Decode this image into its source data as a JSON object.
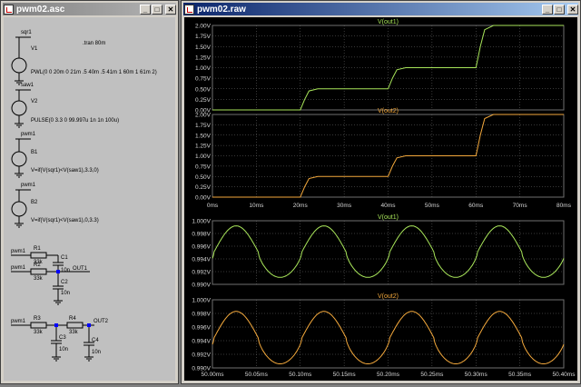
{
  "schematic_window": {
    "title": "pwm02.asc",
    "controls": {
      "minimize": "_",
      "maximize": "□",
      "close": "✕"
    },
    "directive": ".tran 80m",
    "sources": [
      {
        "net": "sqr1",
        "ref": "V1",
        "value": "PWL(0 0 20m 0 21m .5 40m .5 41m 1 60m 1 61m 2)"
      },
      {
        "net": "saw1",
        "ref": "V2",
        "value": "PULSE(0 3.3 0 99.997u 1n 1n 100u)"
      },
      {
        "net": "pwm1",
        "ref": "B1",
        "value": "V=if(V(sqr1)<V(saw1),3.3,0)"
      },
      {
        "net": "pwm1",
        "ref": "B2",
        "value": "V=if(V(sqr1)<V(saw1),0,3.3)"
      }
    ],
    "filter1": {
      "in1": "pwm1",
      "in2": "pwm1",
      "r1": "R1",
      "r1_val": "33k",
      "r2": "R2",
      "r2_val": "33k",
      "c1": "C1",
      "c1_val": "10n",
      "c2": "C2",
      "c2_val": "10n",
      "out": "OUT1"
    },
    "filter2": {
      "in": "pwm1",
      "r3": "R3",
      "r3_val": "33k",
      "r4": "R4",
      "r4_val": "33k",
      "c3": "C3",
      "c3_val": "10n",
      "c4": "C4",
      "c4_val": "10n",
      "out": "OUT2"
    }
  },
  "waveform_window": {
    "title": "pwm02.raw",
    "controls": {
      "minimize": "_",
      "maximize": "□",
      "close": "✕"
    }
  },
  "colors": {
    "out1": "#a8e55a",
    "out2": "#f4a93c",
    "grid": "#707070",
    "axis_text": "#d8d8d8",
    "background": "#000000"
  },
  "chart_data": [
    {
      "type": "line",
      "title": "V(out1)",
      "x_unit": "ms",
      "xlim": [
        0,
        80
      ],
      "x_tick_labels": [
        "0ms",
        "10ms",
        "20ms",
        "30ms",
        "40ms",
        "50ms",
        "60ms",
        "70ms",
        "80ms"
      ],
      "ylim": [
        0,
        2.0
      ],
      "y_tick_labels": [
        "2.00V",
        "1.75V",
        "1.50V",
        "1.25V",
        "1.00V",
        "0.75V",
        "0.50V",
        "0.25V",
        "0.00V"
      ],
      "grid": true,
      "series": [
        {
          "name": "V(out1)",
          "x": [
            0,
            20,
            21,
            22,
            24,
            40,
            41,
            42,
            44,
            60,
            61,
            62,
            64,
            80
          ],
          "y": [
            0,
            0,
            0.25,
            0.45,
            0.5,
            0.5,
            0.75,
            0.95,
            1.0,
            1.0,
            1.5,
            1.9,
            2.0,
            2.0
          ]
        }
      ]
    },
    {
      "type": "line",
      "title": "V(out2)",
      "x_unit": "ms",
      "xlim": [
        0,
        80
      ],
      "x_tick_labels": [
        "0ms",
        "10ms",
        "20ms",
        "30ms",
        "40ms",
        "50ms",
        "60ms",
        "70ms",
        "80ms"
      ],
      "ylim": [
        0,
        2.0
      ],
      "y_tick_labels": [
        "2.00V",
        "1.75V",
        "1.50V",
        "1.25V",
        "1.00V",
        "0.75V",
        "0.50V",
        "0.25V",
        "0.00V"
      ],
      "grid": true,
      "series": [
        {
          "name": "V(out2)",
          "x": [
            0,
            20,
            21,
            22,
            24,
            40,
            41,
            42,
            44,
            60,
            61,
            62,
            64,
            80
          ],
          "y": [
            0,
            0,
            0.25,
            0.45,
            0.5,
            0.5,
            0.75,
            0.95,
            1.0,
            1.0,
            1.5,
            1.9,
            2.0,
            2.0
          ]
        }
      ]
    },
    {
      "type": "line",
      "title": "V(out1)",
      "x_unit": "ms",
      "xlim": [
        50.0,
        50.4
      ],
      "x_tick_labels": [
        "50.00ms",
        "50.05ms",
        "50.10ms",
        "50.15ms",
        "50.20ms",
        "50.25ms",
        "50.30ms",
        "50.35ms",
        "50.40ms"
      ],
      "ylim": [
        0.99,
        1.0
      ],
      "y_tick_labels": [
        "1.000V",
        "0.998V",
        "0.996V",
        "0.994V",
        "0.992V",
        "0.990V"
      ],
      "grid": true,
      "series": [
        {
          "name": "V(out1)",
          "period_ms": 0.1,
          "x_first_peak": 50.027,
          "y_peak": 0.9992,
          "y_trough": 0.9911
        }
      ]
    },
    {
      "type": "line",
      "title": "V(out2)",
      "x_unit": "ms",
      "xlim": [
        50.0,
        50.4
      ],
      "x_tick_labels": [
        "50.00ms",
        "50.05ms",
        "50.10ms",
        "50.15ms",
        "50.20ms",
        "50.25ms",
        "50.30ms",
        "50.35ms",
        "50.40ms"
      ],
      "ylim": [
        0.99,
        1.0
      ],
      "y_tick_labels": [
        "1.000V",
        "0.998V",
        "0.996V",
        "0.994V",
        "0.992V",
        "0.990V"
      ],
      "grid": true,
      "series": [
        {
          "name": "V(out2)",
          "period_ms": 0.1,
          "x_first_peak": 50.027,
          "y_peak": 0.9983,
          "y_trough": 0.9906
        }
      ]
    }
  ]
}
